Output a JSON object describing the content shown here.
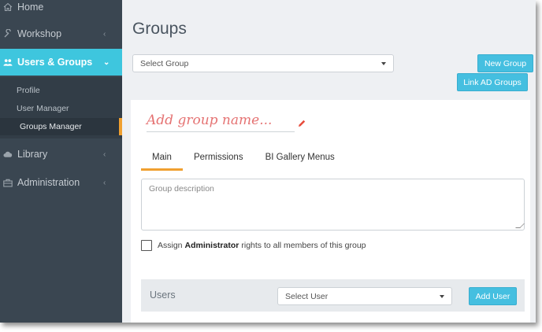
{
  "sidebar": {
    "items": [
      {
        "label": "Home"
      },
      {
        "label": "Workshop"
      },
      {
        "label": "Users & Groups"
      },
      {
        "label": "Library"
      },
      {
        "label": "Administration"
      }
    ],
    "submenu": [
      {
        "label": "Profile"
      },
      {
        "label": "User Manager"
      },
      {
        "label": "Groups Manager"
      }
    ]
  },
  "main": {
    "title": "Groups",
    "select_group": "Select Group",
    "new_group": "New Group",
    "link_ad_groups": "Link AD Groups",
    "group_name_placeholder": "Add group name...",
    "tabs": [
      {
        "label": "Main"
      },
      {
        "label": "Permissions"
      },
      {
        "label": "BI Gallery Menus"
      }
    ],
    "description_placeholder": "Group description",
    "assign_prefix": "Assign",
    "assign_bold": "Administrator",
    "assign_suffix": "rights to all members of this group",
    "users_label": "Users",
    "select_user": "Select User",
    "add_user": "Add User"
  },
  "colors": {
    "sidebar_bg": "#3a4651",
    "accent": "#3ec6de",
    "button": "#45bfe0",
    "active_marker": "#f0a030",
    "placeholder_red": "#e57373"
  }
}
